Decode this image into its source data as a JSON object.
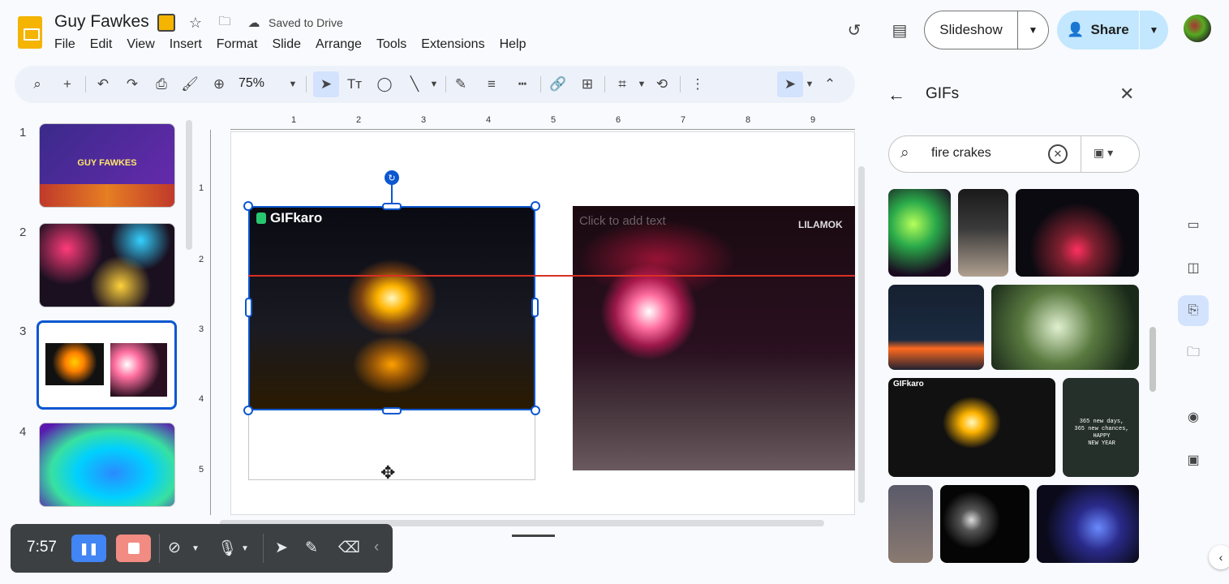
{
  "header": {
    "doc_title": "Guy Fawkes",
    "save_status": "Saved to Drive",
    "menu": [
      "File",
      "Edit",
      "View",
      "Insert",
      "Format",
      "Slide",
      "Arrange",
      "Tools",
      "Extensions",
      "Help"
    ],
    "slideshow_label": "Slideshow",
    "share_label": "Share"
  },
  "toolbar": {
    "zoom": "75%"
  },
  "filmstrip": {
    "slides": [
      {
        "number": "1",
        "title": "GUY FAWKES"
      },
      {
        "number": "2"
      },
      {
        "number": "3"
      },
      {
        "number": "4"
      }
    ]
  },
  "canvas": {
    "ruler_h": [
      "1",
      "2",
      "3",
      "4",
      "5",
      "6",
      "7",
      "8",
      "9"
    ],
    "ruler_v": [
      "1",
      "2",
      "3",
      "4",
      "5"
    ],
    "left_gif_watermark": "GIFkaro",
    "right_placeholder": "Click to add text",
    "right_watermark": "LILAMOK"
  },
  "gif_panel": {
    "title": "GIFs",
    "search_value": "fire crakes",
    "tile_watermark": "GIFkaro",
    "tile_caption": "365 new days,\n365 new chances,\nHAPPY\nNEW YEAR"
  },
  "recorder": {
    "time": "7:57"
  },
  "colors": {
    "accent": "#0b57d0",
    "share_bg": "#c2e7ff",
    "guide": "#d93025",
    "slides_brand": "#f4b400"
  }
}
